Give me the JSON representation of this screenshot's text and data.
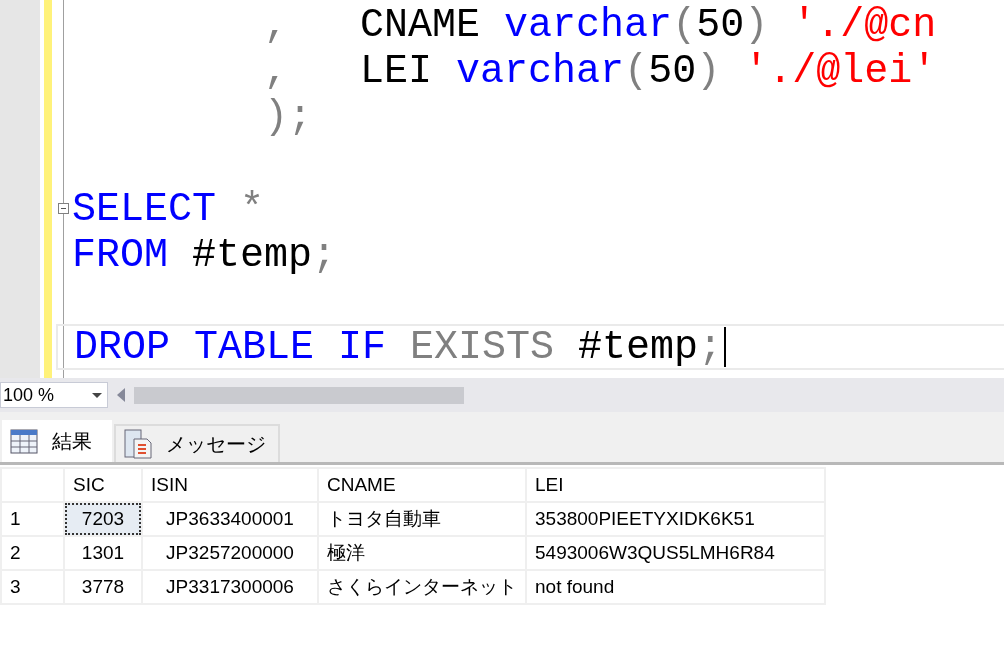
{
  "editor": {
    "lines": [
      {
        "current": false,
        "foldable": false,
        "tokens": [
          {
            "kind": "punct",
            "text": "        ,"
          },
          {
            "kind": "plain",
            "text": "   CNAME "
          },
          {
            "kind": "keyword",
            "text": "varchar"
          },
          {
            "kind": "punct",
            "text": "("
          },
          {
            "kind": "plain",
            "text": "50"
          },
          {
            "kind": "punct",
            "text": ")"
          },
          {
            "kind": "string",
            "text": " './@cn"
          }
        ]
      },
      {
        "current": false,
        "foldable": false,
        "tokens": [
          {
            "kind": "punct",
            "text": "        ,"
          },
          {
            "kind": "plain",
            "text": "   LEI "
          },
          {
            "kind": "keyword",
            "text": "varchar"
          },
          {
            "kind": "punct",
            "text": "("
          },
          {
            "kind": "plain",
            "text": "50"
          },
          {
            "kind": "punct",
            "text": ")"
          },
          {
            "kind": "string",
            "text": " './@lei'"
          }
        ]
      },
      {
        "current": false,
        "foldable": false,
        "tokens": [
          {
            "kind": "punct",
            "text": "        );"
          }
        ]
      },
      {
        "current": false,
        "foldable": false
      },
      {
        "current": false,
        "foldable": true,
        "tokens": [
          {
            "kind": "keyword",
            "text": "SELECT"
          },
          {
            "kind": "punct",
            "text": " *"
          }
        ]
      },
      {
        "current": false,
        "foldable": false,
        "tokens": [
          {
            "kind": "keyword",
            "text": "FROM"
          },
          {
            "kind": "plain",
            "text": " #temp"
          },
          {
            "kind": "punct",
            "text": ";"
          }
        ]
      },
      {
        "current": false,
        "foldable": false
      },
      {
        "current": true,
        "foldable": false,
        "tokens": [
          {
            "kind": "keyword",
            "text": "DROP TABLE IF"
          },
          {
            "kind": "punct",
            "text": " EXISTS"
          },
          {
            "kind": "plain",
            "text": " #temp"
          },
          {
            "kind": "punct",
            "text": ";"
          }
        ]
      }
    ]
  },
  "zoom": {
    "value": "100 %"
  },
  "tabs": [
    {
      "label": "結果",
      "selected": true
    },
    {
      "label": "メッセージ",
      "selected": false
    }
  ],
  "grid": {
    "columns": [
      "SIC",
      "ISIN",
      "CNAME",
      "LEI"
    ],
    "rows": [
      {
        "number": "1",
        "cells": [
          {
            "text": "7203",
            "selected": true
          },
          {
            "text": "JP3633400001",
            "selected": false
          },
          {
            "text": "トヨタ自動車",
            "selected": false
          },
          {
            "text": "353800PIEETYXIDK6K51",
            "selected": false
          }
        ]
      },
      {
        "number": "2",
        "cells": [
          {
            "text": "1301",
            "selected": false
          },
          {
            "text": "JP3257200000",
            "selected": false
          },
          {
            "text": "極洋",
            "selected": false
          },
          {
            "text": "5493006W3QUS5LMH6R84",
            "selected": false
          }
        ]
      },
      {
        "number": "3",
        "cells": [
          {
            "text": "3778",
            "selected": false
          },
          {
            "text": "JP3317300006",
            "selected": false
          },
          {
            "text": "さくらインターネット",
            "selected": false
          },
          {
            "text": "not found",
            "selected": false
          }
        ]
      }
    ]
  }
}
